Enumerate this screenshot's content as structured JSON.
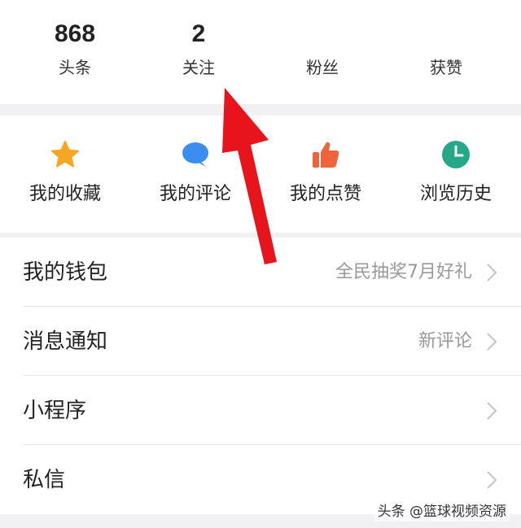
{
  "stats": [
    {
      "value": "868",
      "label": "头条"
    },
    {
      "value": "2",
      "label": "关注"
    },
    {
      "value": "",
      "label": "粉丝"
    },
    {
      "value": "",
      "label": "获赞"
    }
  ],
  "shortcuts": [
    {
      "label": "我的收藏",
      "icon": "star-icon",
      "color": "#f5a623"
    },
    {
      "label": "我的评论",
      "icon": "comment-bubble-icon",
      "color": "#3a8ef0"
    },
    {
      "label": "我的点赞",
      "icon": "thumbs-up-icon",
      "color": "#f0643c"
    },
    {
      "label": "浏览历史",
      "icon": "clock-icon",
      "color": "#25a887"
    }
  ],
  "list": [
    {
      "title": "我的钱包",
      "hint": "全民抽奖7月好礼"
    },
    {
      "title": "消息通知",
      "hint": "新评论"
    },
    {
      "title": "小程序",
      "hint": ""
    },
    {
      "title": "私信",
      "hint": ""
    }
  ],
  "watermark": "头条 @篮球视频资源",
  "colors": {
    "annotation_arrow": "#e8141c",
    "chevron": "#c8c8c8"
  }
}
